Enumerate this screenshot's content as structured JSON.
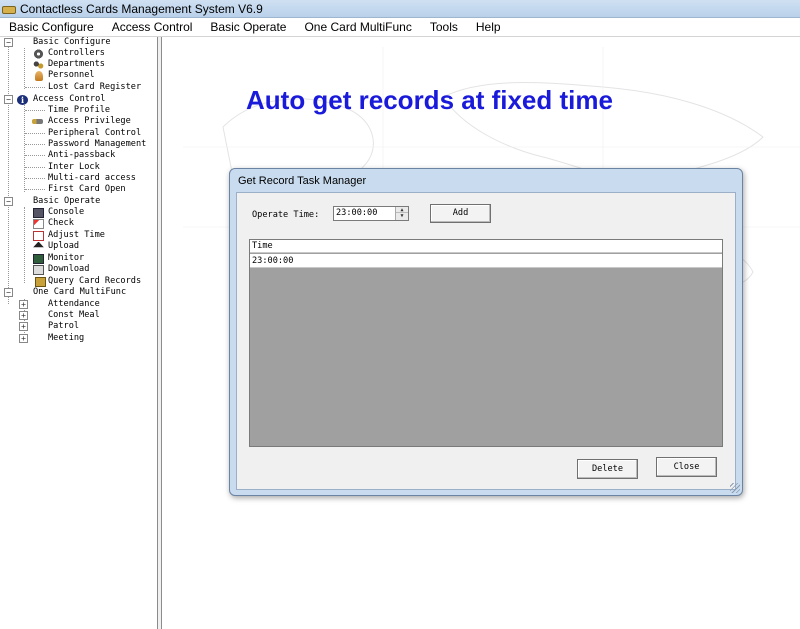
{
  "window": {
    "title": "Contactless Cards Management System  V6.9"
  },
  "menu": [
    {
      "label": "Basic Configure"
    },
    {
      "label": "Access Control"
    },
    {
      "label": "Basic Operate"
    },
    {
      "label": "One Card MultiFunc"
    },
    {
      "label": "Tools"
    },
    {
      "label": "Help"
    }
  ],
  "tree": {
    "groups": [
      {
        "label": "Basic Configure",
        "expander": "−",
        "items": [
          {
            "label": "Controllers",
            "icon": "gear-icon"
          },
          {
            "label": "Departments",
            "icon": "departments-icon"
          },
          {
            "label": "Personnel",
            "icon": "person-icon"
          },
          {
            "label": "Lost Card Register",
            "icon": ""
          }
        ]
      },
      {
        "label": "Access Control",
        "expander": "−",
        "icon": "info-icon",
        "items": [
          {
            "label": "Time Profile",
            "icon": ""
          },
          {
            "label": "Access Privilege",
            "icon": "key-icon"
          },
          {
            "label": "Peripheral Control",
            "icon": ""
          },
          {
            "label": "Password Management",
            "icon": ""
          },
          {
            "label": "Anti-passback",
            "icon": ""
          },
          {
            "label": "Inter Lock",
            "icon": ""
          },
          {
            "label": "Multi-card access",
            "icon": ""
          },
          {
            "label": "First Card Open",
            "icon": ""
          }
        ]
      },
      {
        "label": "Basic Operate",
        "expander": "−",
        "items": [
          {
            "label": "Console",
            "icon": "console-icon"
          },
          {
            "label": "Check",
            "icon": "check-icon"
          },
          {
            "label": "Adjust Time",
            "icon": "clock-icon"
          },
          {
            "label": "Upload",
            "icon": "upload-icon"
          },
          {
            "label": "Monitor",
            "icon": "monitor-icon"
          },
          {
            "label": "Download",
            "icon": "download-icon"
          },
          {
            "label": "Query Card Records",
            "icon": "query-icon"
          }
        ]
      },
      {
        "label": "One Card MultiFunc",
        "expander": "−",
        "items": [
          {
            "label": "Attendance",
            "expander": "+"
          },
          {
            "label": "Const Meal",
            "expander": "+"
          },
          {
            "label": "Patrol",
            "expander": "+"
          },
          {
            "label": "Meeting",
            "expander": "+"
          }
        ]
      }
    ]
  },
  "banner": {
    "text": "Auto get records at fixed time",
    "color": "#1a1adb"
  },
  "dialog": {
    "title": "Get Record Task Manager",
    "operate_time_label": "Operate Time:",
    "operate_time_value": "23:00:00",
    "add_label": "Add",
    "grid": {
      "column": "Time",
      "rows": [
        "23:00:00"
      ]
    },
    "delete_label": "Delete",
    "close_label": "Close"
  }
}
